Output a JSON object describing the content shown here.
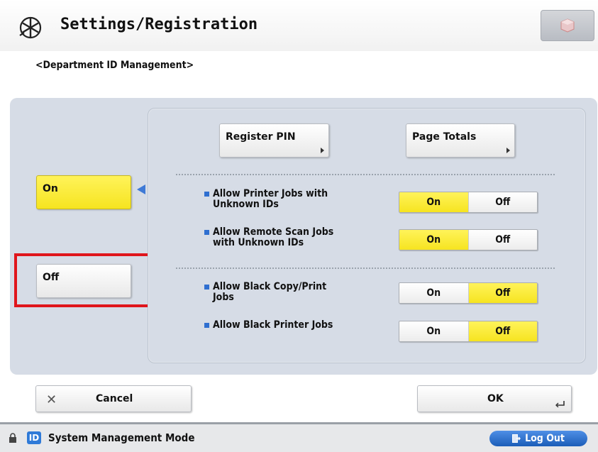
{
  "header": {
    "title": "Settings/Registration",
    "icon": "settings-asterisk-icon",
    "right_button_icon": "status-box-icon"
  },
  "subtitle": "<Department ID Management>",
  "mode_buttons": {
    "on_label": "On",
    "off_label": "Off",
    "selected": "On"
  },
  "top_buttons": {
    "register_pin": "Register PIN",
    "page_totals": "Page Totals"
  },
  "options": [
    {
      "line1": "Allow Printer Jobs with",
      "line2": "Unknown IDs",
      "on": "On",
      "off": "Off",
      "selected": "On"
    },
    {
      "line1": "Allow Remote Scan Jobs",
      "line2": "with Unknown IDs",
      "on": "On",
      "off": "Off",
      "selected": "On"
    },
    {
      "line1": "Allow Black Copy/Print",
      "line2": "Jobs",
      "on": "On",
      "off": "Off",
      "selected": "Off"
    },
    {
      "line1": "Allow Black Printer Jobs",
      "line2": "",
      "on": "On",
      "off": "Off",
      "selected": "Off"
    }
  ],
  "actions": {
    "cancel": "Cancel",
    "ok": "OK"
  },
  "footer": {
    "mode_text": "System Management Mode",
    "id_badge": "ID",
    "logout": "Log Out"
  },
  "colors": {
    "selected_yellow": "#f6e420",
    "accent_blue": "#2f6fd0",
    "highlight_red": "#e0161c"
  }
}
